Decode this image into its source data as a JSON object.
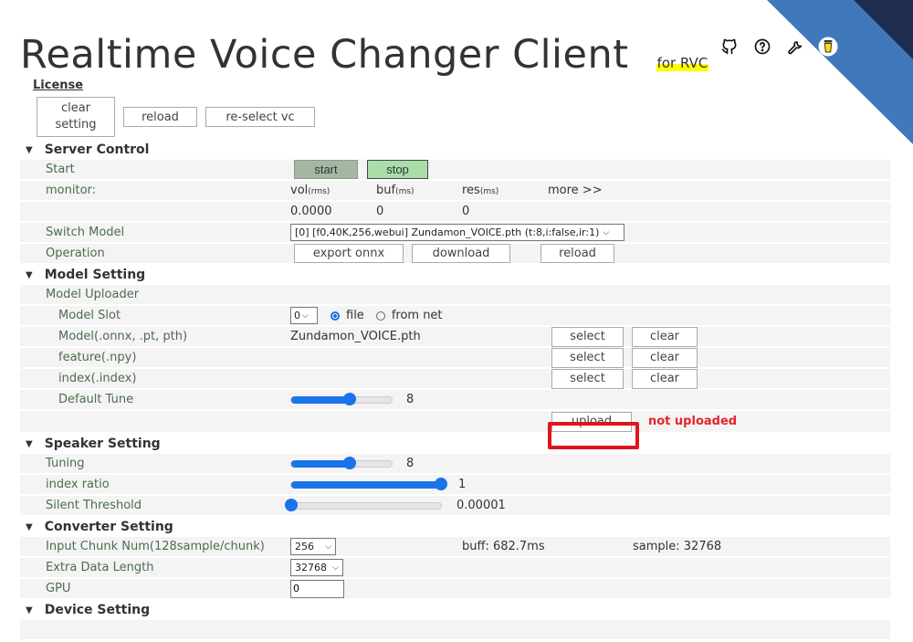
{
  "header": {
    "title": "Realtime Voice Changer Client",
    "subtitle": "for RVC",
    "icons": [
      "github-icon",
      "help-icon",
      "wrench-icon",
      "coffee-icon"
    ]
  },
  "top": {
    "license_link": "License",
    "buttons": {
      "clear_setting_line1": "clear",
      "clear_setting_line2": "setting",
      "reload": "reload",
      "reselect_vc": "re-select vc"
    }
  },
  "server_control": {
    "title": "Server Control",
    "start_label": "Start",
    "start_button": "start",
    "stop_button": "stop",
    "monitor_label": "monitor:",
    "monitor": {
      "vol": "vol",
      "vol_unit": "(rms)",
      "buf": "buf",
      "buf_unit": "(ms)",
      "res": "res",
      "res_unit": "(ms)",
      "more": "more >>",
      "vol_value": "0.0000",
      "buf_value": "0",
      "res_value": "0"
    },
    "switch_model_label": "Switch Model",
    "switch_model_value": "[0] [f0,40K,256,webui] Zundamon_VOICE.pth (t:8,i:false,ir:1)",
    "operation_label": "Operation",
    "operation_buttons": {
      "export_onnx": "export onnx",
      "download": "download",
      "reload": "reload"
    }
  },
  "model_setting": {
    "title": "Model Setting",
    "uploader_label": "Model Uploader",
    "slot_label": "Model Slot",
    "slot_value": "0",
    "radio_file": "file",
    "radio_net": "from net",
    "radio_selected": "file",
    "model_label": "Model(.onnx, .pt, pth)",
    "model_file": "Zundamon_VOICE.pth",
    "feature_label": "feature(.npy)",
    "index_label": "index(.index)",
    "select_button": "select",
    "clear_button": "clear",
    "default_tune_label": "Default Tune",
    "default_tune_value": "8",
    "default_tune_fraction": 0.58,
    "upload_button": "upload",
    "upload_status": "not uploaded",
    "upload_status_color": "#e8232b"
  },
  "speaker_setting": {
    "title": "Speaker Setting",
    "tuning_label": "Tuning",
    "tuning_value": "8",
    "tuning_fraction": 0.58,
    "index_ratio_label": "index ratio",
    "index_ratio_value": "1",
    "index_ratio_fraction": 1.0,
    "silent_threshold_label": "Silent Threshold",
    "silent_threshold_value": "0.00001",
    "silent_threshold_fraction": 0.0
  },
  "converter_setting": {
    "title": "Converter Setting",
    "input_chunk_label": "Input Chunk Num(128sample/chunk)",
    "input_chunk_value": "256",
    "buff_text": "buff: 682.7ms",
    "sample_text": "sample: 32768",
    "extra_data_label": "Extra Data Length",
    "extra_data_value": "32768",
    "gpu_label": "GPU",
    "gpu_value": "0"
  },
  "device_setting": {
    "title": "Device Setting"
  },
  "colors": {
    "accent": "#1a73e8",
    "corner_light": "#4178bc",
    "corner_dark": "#1f2d4f",
    "highlight": "#ffff00",
    "stop_button": "#a9dea9",
    "start_button": "#a3b7a3"
  }
}
